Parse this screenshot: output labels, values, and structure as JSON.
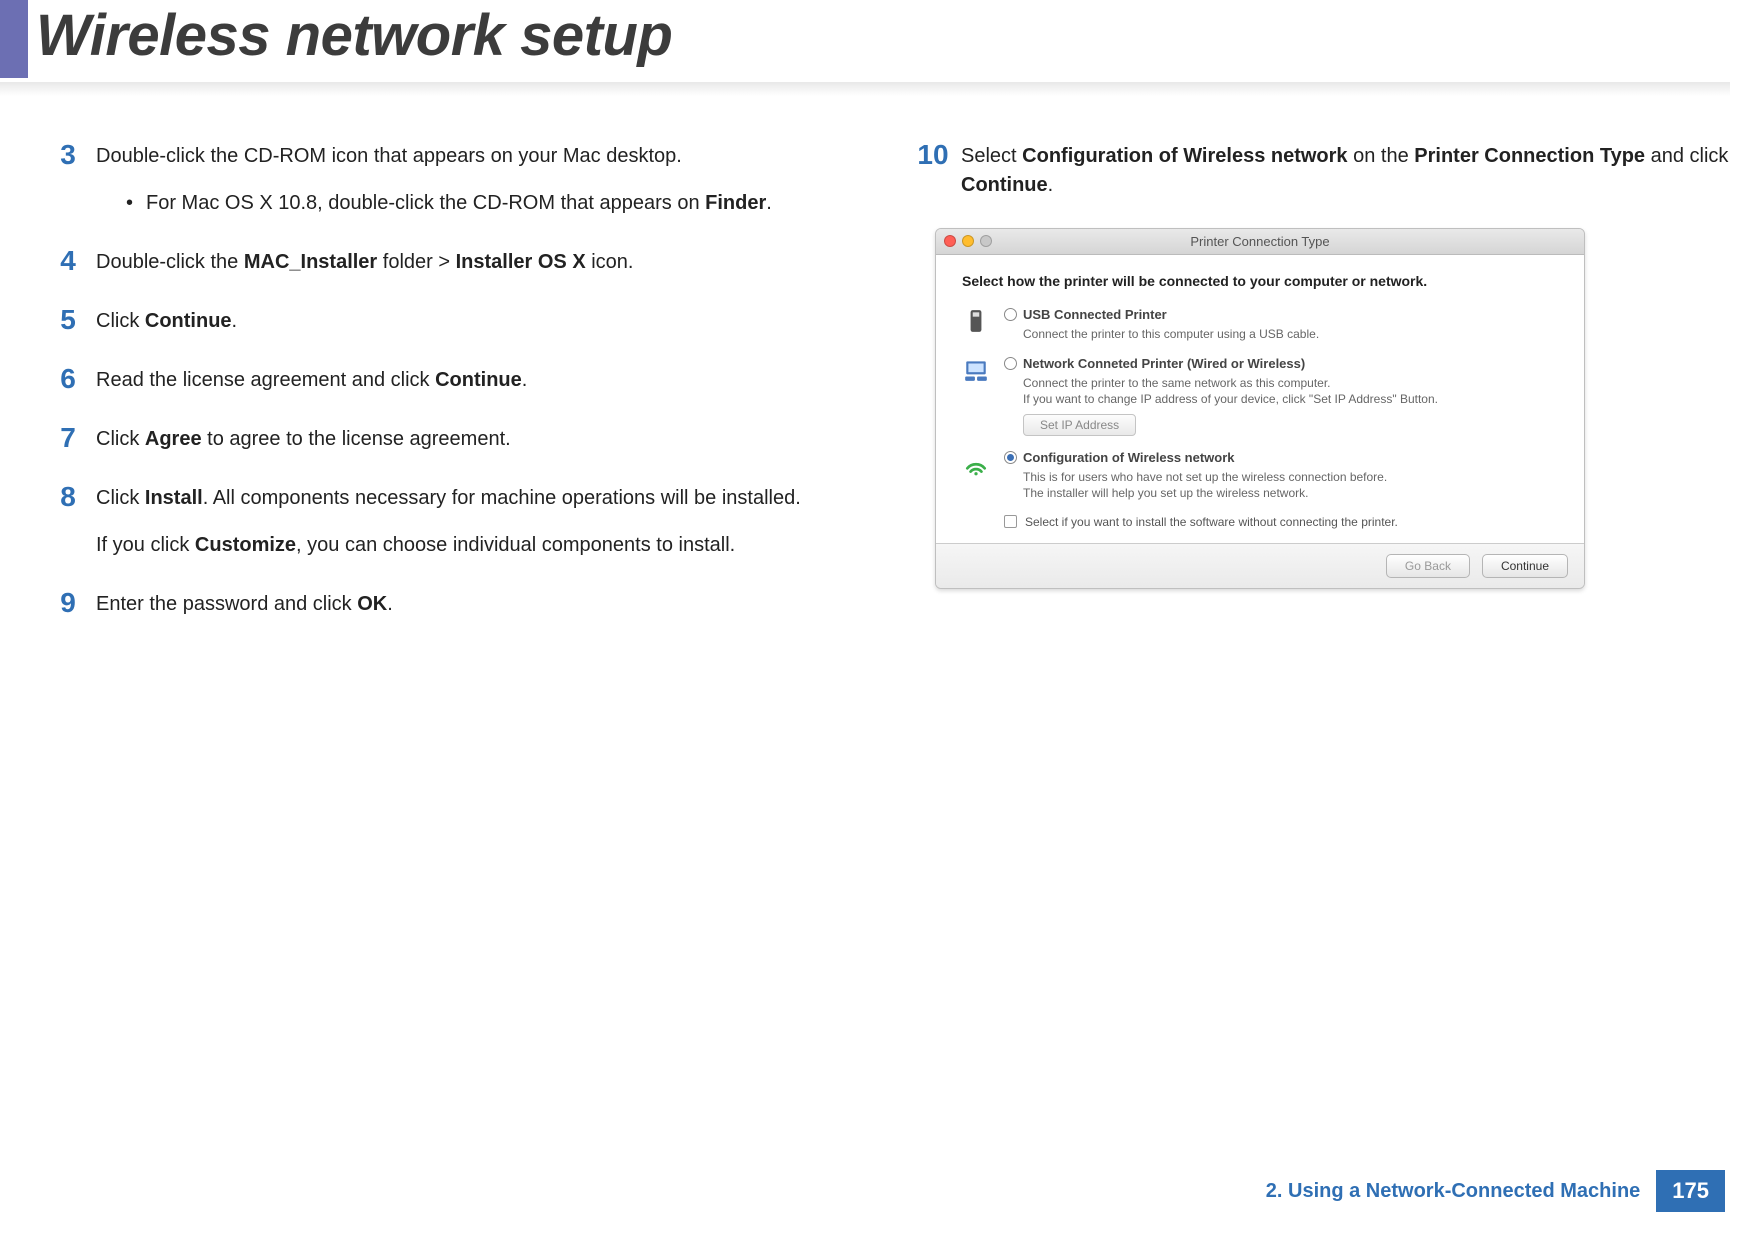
{
  "page_title": "Wireless network setup",
  "steps_left": [
    {
      "num": "3",
      "segments": [
        {
          "t": "Double-click the CD-ROM icon that appears on your Mac desktop."
        }
      ],
      "sub": [
        {
          "pre": "For Mac OS X 10.8, double-click the CD-ROM that appears on ",
          "bold": "Finder",
          "post": "."
        }
      ]
    },
    {
      "num": "4",
      "segments": [
        {
          "t": "Double-click the "
        },
        {
          "b": "MAC_Installer"
        },
        {
          "t": " folder > "
        },
        {
          "b": "Installer OS X"
        },
        {
          "t": " icon."
        }
      ]
    },
    {
      "num": "5",
      "segments": [
        {
          "t": "Click "
        },
        {
          "b": "Continue"
        },
        {
          "t": "."
        }
      ]
    },
    {
      "num": "6",
      "segments": [
        {
          "t": "Read the license agreement and click "
        },
        {
          "b": "Continue"
        },
        {
          "t": "."
        }
      ]
    },
    {
      "num": "7",
      "segments": [
        {
          "t": "Click "
        },
        {
          "b": "Agree"
        },
        {
          "t": " to agree to the license agreement."
        }
      ]
    },
    {
      "num": "8",
      "segments": [
        {
          "t": "Click "
        },
        {
          "b": "Install"
        },
        {
          "t": ". All components necessary for machine operations will be installed."
        }
      ],
      "para2": [
        {
          "t": "If you click "
        },
        {
          "b": "Customize"
        },
        {
          "t": ", you can choose individual components to install."
        }
      ]
    },
    {
      "num": "9",
      "segments": [
        {
          "t": "Enter the password and click "
        },
        {
          "b": "OK"
        },
        {
          "t": "."
        }
      ]
    }
  ],
  "step_right": {
    "num": "10",
    "segments": [
      {
        "t": "Select "
      },
      {
        "b": "Configuration of Wireless network"
      },
      {
        "t": " on the "
      },
      {
        "b": "Printer Connection Type"
      },
      {
        "t": " and click "
      },
      {
        "b": "Continue"
      },
      {
        "t": "."
      }
    ]
  },
  "dialog": {
    "title": "Printer Connection Type",
    "heading": "Select how the printer will be connected to your computer or network.",
    "options": [
      {
        "id": "usb",
        "label": "USB Connected Printer",
        "desc": "Connect the printer to this computer using a USB cable.",
        "selected": false
      },
      {
        "id": "net",
        "label": "Network Conneted Printer (Wired or Wireless)",
        "desc": "Connect the printer to the same network as this computer.\nIf you want to change IP address of your device, click \"Set IP Address\" Button.",
        "selected": false,
        "button": "Set IP Address"
      },
      {
        "id": "wifi",
        "label": "Configuration of Wireless network",
        "desc": "This is for users who have not set up the wireless connection before.\nThe installer will help you set up the wireless network.",
        "selected": true
      }
    ],
    "checkbox": "Select if you want to install the software without connecting the printer.",
    "go_back": "Go Back",
    "continue": "Continue"
  },
  "footer": {
    "chapter": "2.  Using a Network-Connected Machine",
    "page": "175"
  }
}
